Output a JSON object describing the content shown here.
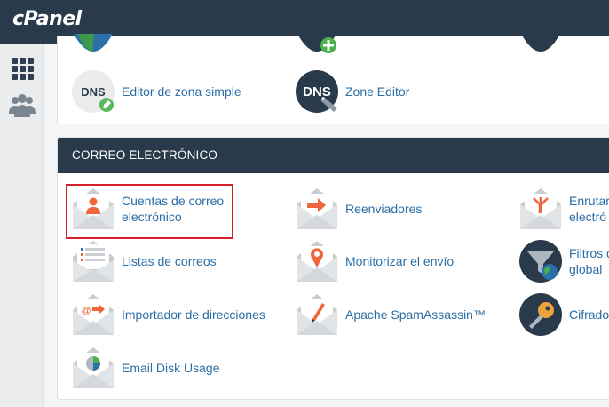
{
  "header": {
    "logo": "cPanel"
  },
  "sidebar": {
    "items": [
      {
        "icon": "apps-grid-icon"
      },
      {
        "icon": "users-icon"
      }
    ]
  },
  "domains_section": {
    "items": [
      {
        "label": "Editor de zona simple",
        "icon": "dns-edit-icon"
      },
      {
        "label": "Zone Editor",
        "icon": "dns-zone-icon"
      }
    ]
  },
  "email_section": {
    "title": "CORREO ELECTRÓNICO",
    "items": [
      {
        "label_line1": "Cuentas de correo",
        "label_line2": "electrónico",
        "icon": "email-accounts-icon",
        "highlighted": true
      },
      {
        "label": "Reenviadores",
        "icon": "forwarders-icon"
      },
      {
        "label_line1": "Enrutar",
        "label_line2": "electró",
        "icon": "email-routing-icon"
      },
      {
        "label": "Listas de correos",
        "icon": "mailing-lists-icon"
      },
      {
        "label": "Monitorizar el envío",
        "icon": "track-delivery-icon"
      },
      {
        "label_line1": "Filtros d",
        "label_line2": "global",
        "icon": "global-filters-icon"
      },
      {
        "label": "Importador de direcciones",
        "icon": "address-importer-icon"
      },
      {
        "label": "Apache SpamAssassin™",
        "icon": "spam-assassin-icon"
      },
      {
        "label": "Cifrado",
        "icon": "encryption-icon"
      },
      {
        "label": "Email Disk Usage",
        "icon": "email-disk-usage-icon"
      }
    ]
  },
  "colors": {
    "topbar": "#293a4a",
    "link": "#2b6ea6",
    "highlight": "#d6202b",
    "accent_orange": "#f0653a"
  }
}
